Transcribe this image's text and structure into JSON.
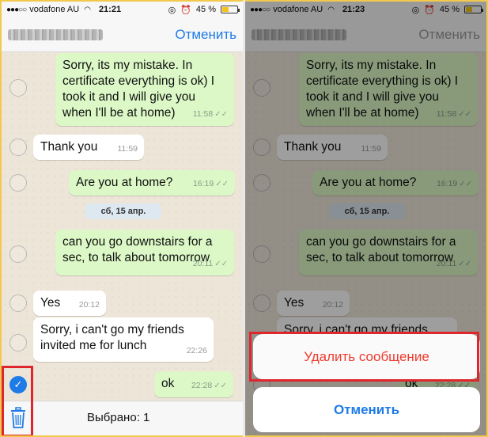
{
  "left": {
    "status": {
      "carrier": "vodafone AU",
      "time": "21:21",
      "battery": "45 %",
      "battery_level": 0.45
    },
    "nav": {
      "cancel": "Отменить"
    },
    "messages": [
      {
        "dir": "out",
        "text": "Sorry, its my mistake. In certificate everything is ok) I took it and I will give you when I'll be at home)",
        "time": "11:58",
        "checked": false
      },
      {
        "dir": "in",
        "text": "Thank you",
        "time": "11:59",
        "checked": false
      },
      {
        "dir": "out",
        "text": "Are you at home?",
        "time": "16:19",
        "checked": false
      },
      {
        "dir": "out",
        "text": "can you go downstairs for a sec, to talk about tomorrow",
        "time": "20:11",
        "checked": false
      },
      {
        "dir": "in",
        "text": "Yes",
        "time": "20:12",
        "checked": false
      },
      {
        "dir": "in",
        "text": "Sorry, i can't go my friends invited me for lunch",
        "time": "22:26",
        "checked": false
      },
      {
        "dir": "out",
        "text": "ok",
        "time": "22:28",
        "checked": true
      }
    ],
    "date_separator": "сб, 15 апр.",
    "bottom": {
      "selected": "Выбрано: 1"
    }
  },
  "right": {
    "status": {
      "carrier": "vodafone AU",
      "time": "21:23",
      "battery": "45 %",
      "battery_level": 0.45
    },
    "nav": {
      "cancel": "Отменить"
    },
    "action_sheet": {
      "delete": "Удалить сообщение",
      "cancel": "Отменить"
    }
  },
  "colors": {
    "accent": "#1e7be7",
    "destructive": "#ef3b2f",
    "outgoing_bubble": "#dcf8c6",
    "highlight": "#e0262d"
  }
}
